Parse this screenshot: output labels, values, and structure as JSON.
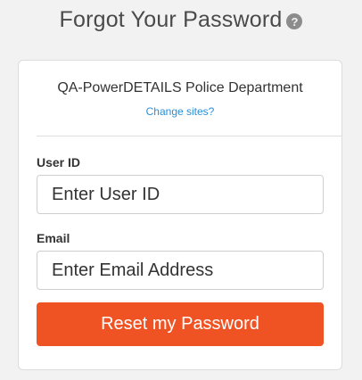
{
  "header": {
    "title": "Forgot Your Password",
    "help_icon": "question-circle-icon",
    "help_glyph": "?"
  },
  "card": {
    "site_name": "QA-PowerDETAILS Police Department",
    "change_sites_link": "Change sites?"
  },
  "form": {
    "user_id": {
      "label": "User ID",
      "placeholder": "Enter User ID",
      "value": ""
    },
    "email": {
      "label": "Email",
      "placeholder": "Enter Email Address",
      "value": ""
    },
    "submit_label": "Reset my Password"
  },
  "colors": {
    "background": "#f2f2f2",
    "card": "#ffffff",
    "accent_button": "#f05323",
    "link": "#2a8fd6",
    "help_icon": "#8c8c8c"
  }
}
